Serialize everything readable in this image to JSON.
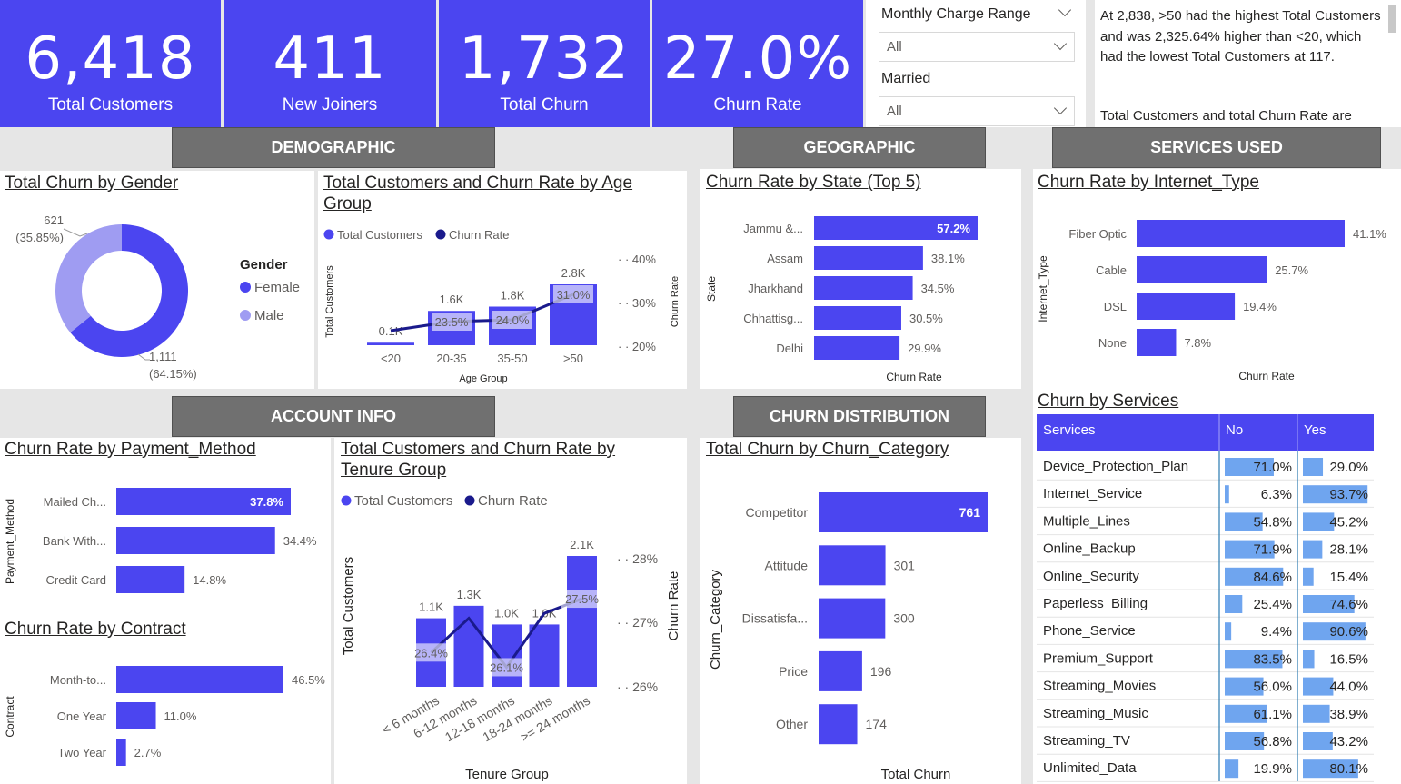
{
  "kpis": [
    {
      "value": "6,418",
      "label": "Total Customers"
    },
    {
      "value": "411",
      "label": "New Joiners"
    },
    {
      "value": "1,732",
      "label": "Total Churn"
    },
    {
      "value": "27.0%",
      "label": "Churn Rate"
    }
  ],
  "slicers": {
    "monthly_charge": {
      "label": "Monthly Charge Range",
      "value": "All"
    },
    "married": {
      "label": "Married",
      "value": "All"
    }
  },
  "insight": {
    "line1": "At 2,838, >50 had the highest Total Customers and was 2,325.64% higher than <20, which had the lowest Total Customers at 117.",
    "line2": "Total Customers and total Churn Rate are"
  },
  "sections": {
    "demographic": "DEMOGRAPHIC",
    "geographic": "GEOGRAPHIC",
    "services_used": "SERVICES USED",
    "account_info": "ACCOUNT INFO",
    "churn_distribution": "CHURN DISTRIBUTION"
  },
  "colors": {
    "primary": "#4b45f0",
    "light": "#9f9cf2",
    "dark_line": "#1a1a8c",
    "header_gray": "#707070"
  },
  "chart_data": [
    {
      "id": "gender",
      "type": "pie",
      "title": "Total Churn by Gender",
      "legend_title": "Gender",
      "categories": [
        "Female",
        "Male"
      ],
      "values": [
        1111,
        621
      ],
      "labels": [
        "1,111",
        "621"
      ],
      "pct_labels": [
        "(64.15%)",
        "(35.85%)"
      ]
    },
    {
      "id": "age",
      "type": "bar",
      "title": "Total Customers and Churn Rate by Age Group",
      "legend": [
        "Total Customers",
        "Churn Rate"
      ],
      "categories": [
        "<20",
        "20-35",
        "35-50",
        ">50"
      ],
      "series": [
        {
          "name": "Total Customers",
          "values": [
            117,
            1600,
            1800,
            2838
          ],
          "labels": [
            "0.1K",
            "1.6K",
            "1.8K",
            "2.8K"
          ]
        },
        {
          "name": "Churn Rate",
          "values": [
            21.0,
            23.5,
            24.0,
            31.0
          ],
          "labels": [
            "",
            "23.5%",
            "24.0%",
            "31.0%"
          ]
        }
      ],
      "xlabel": "Age Group",
      "ylabel": "Total Customers",
      "y2label": "Churn Rate",
      "y2ticks": [
        "40%",
        "30%",
        "20%"
      ],
      "y2lim": [
        17,
        42
      ]
    },
    {
      "id": "state",
      "type": "bar",
      "title": "Churn Rate by State (Top 5)",
      "categories": [
        "Jammu &...",
        "Assam",
        "Jharkhand",
        "Chhattisg...",
        "Delhi"
      ],
      "values": [
        57.2,
        38.1,
        34.5,
        30.5,
        29.9
      ],
      "labels": [
        "57.2%",
        "38.1%",
        "34.5%",
        "30.5%",
        "29.9%"
      ],
      "xlabel": "Churn Rate",
      "ylabel": "State"
    },
    {
      "id": "internet",
      "type": "bar",
      "title": "Churn Rate by Internet_Type",
      "categories": [
        "Fiber Optic",
        "Cable",
        "DSL",
        "None"
      ],
      "values": [
        41.1,
        25.7,
        19.4,
        7.8
      ],
      "labels": [
        "41.1%",
        "25.7%",
        "19.4%",
        "7.8%"
      ],
      "xlabel": "Churn Rate",
      "ylabel": "Internet_Type"
    },
    {
      "id": "payment",
      "type": "bar",
      "title": "Churn Rate by Payment_Method",
      "categories": [
        "Mailed Ch...",
        "Bank With...",
        "Credit Card"
      ],
      "values": [
        37.8,
        34.4,
        14.8
      ],
      "labels": [
        "37.8%",
        "34.4%",
        "14.8%"
      ],
      "ylabel": "Payment_Method"
    },
    {
      "id": "contract",
      "type": "bar",
      "title": "Churn Rate by Contract",
      "categories": [
        "Month-to...",
        "One Year",
        "Two Year"
      ],
      "values": [
        46.5,
        11.0,
        2.7
      ],
      "labels": [
        "46.5%",
        "11.0%",
        "2.7%"
      ],
      "ylabel": "Contract"
    },
    {
      "id": "tenure",
      "type": "bar",
      "title": "Total Customers and Churn Rate by Tenure Group",
      "legend": [
        "Total Customers",
        "Churn Rate"
      ],
      "categories": [
        "< 6 months",
        "6-12 months",
        "12-18 months",
        "18-24 months",
        ">= 24 months"
      ],
      "series": [
        {
          "name": "Total Customers",
          "values": [
            1100,
            1300,
            1000,
            1000,
            2100
          ],
          "labels": [
            "1.1K",
            "1.3K",
            "1.0K",
            "1.0K",
            "2.1K"
          ]
        },
        {
          "name": "Churn Rate",
          "values": [
            26.4,
            27.1,
            26.1,
            27.2,
            27.5
          ],
          "labels": [
            "26.4%",
            "",
            "26.1%",
            "",
            "27.5%"
          ]
        }
      ],
      "xlabel": "Tenure Group",
      "ylabel": "Total Customers",
      "y2label": "Churn Rate",
      "y2ticks": [
        "28%",
        "27%",
        "26%"
      ],
      "y2lim": [
        25.7,
        28.3
      ]
    },
    {
      "id": "churn_category",
      "type": "bar",
      "title": "Total Churn by Churn_Category",
      "categories": [
        "Competitor",
        "Attitude",
        "Dissatisfa...",
        "Price",
        "Other"
      ],
      "values": [
        761,
        301,
        300,
        196,
        174
      ],
      "labels": [
        "761",
        "301",
        "300",
        "196",
        "174"
      ],
      "xlabel": "Total Churn",
      "ylabel": "Churn_Category"
    },
    {
      "id": "services",
      "type": "table",
      "title": "Churn by Services",
      "columns": [
        "Services",
        "No",
        "Yes"
      ],
      "rows": [
        [
          "Device_Protection_Plan",
          71.0,
          29.0
        ],
        [
          "Internet_Service",
          6.3,
          93.7
        ],
        [
          "Multiple_Lines",
          54.8,
          45.2
        ],
        [
          "Online_Backup",
          71.9,
          28.1
        ],
        [
          "Online_Security",
          84.6,
          15.4
        ],
        [
          "Paperless_Billing",
          25.4,
          74.6
        ],
        [
          "Phone_Service",
          9.4,
          90.6
        ],
        [
          "Premium_Support",
          83.5,
          16.5
        ],
        [
          "Streaming_Movies",
          56.0,
          44.0
        ],
        [
          "Streaming_Music",
          61.1,
          38.9
        ],
        [
          "Streaming_TV",
          56.8,
          43.2
        ],
        [
          "Unlimited_Data",
          19.9,
          80.1
        ]
      ],
      "row_labels": [
        [
          "71.0%",
          "29.0%"
        ],
        [
          "6.3%",
          "93.7%"
        ],
        [
          "54.8%",
          "45.2%"
        ],
        [
          "71.9%",
          "28.1%"
        ],
        [
          "84.6%",
          "15.4%"
        ],
        [
          "25.4%",
          "74.6%"
        ],
        [
          "9.4%",
          "90.6%"
        ],
        [
          "83.5%",
          "16.5%"
        ],
        [
          "56.0%",
          "44.0%"
        ],
        [
          "61.1%",
          "38.9%"
        ],
        [
          "56.8%",
          "43.2%"
        ],
        [
          "19.9%",
          "80.1%"
        ]
      ]
    }
  ]
}
